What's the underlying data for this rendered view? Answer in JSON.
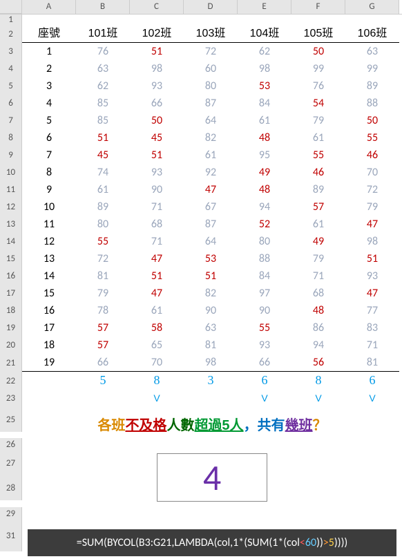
{
  "columns": [
    "A",
    "B",
    "C",
    "D",
    "E",
    "F",
    "G"
  ],
  "row_numbers": [
    1,
    2,
    3,
    4,
    5,
    6,
    7,
    8,
    9,
    10,
    11,
    12,
    13,
    14,
    15,
    16,
    17,
    18,
    19,
    20,
    21,
    22,
    23,
    25,
    26,
    27,
    28,
    29,
    31
  ],
  "header": {
    "seat": "座號",
    "classes": [
      "101班",
      "102班",
      "103班",
      "104班",
      "105班",
      "106班"
    ]
  },
  "threshold": 60,
  "count_threshold": 5,
  "chart_data": {
    "type": "table",
    "title": "各班成績與不及格統計",
    "columns": [
      "座號",
      "101班",
      "102班",
      "103班",
      "104班",
      "105班",
      "106班"
    ],
    "rows": [
      [
        1,
        76,
        51,
        72,
        62,
        50,
        63
      ],
      [
        2,
        63,
        98,
        60,
        98,
        99,
        99
      ],
      [
        3,
        62,
        93,
        80,
        53,
        76,
        89
      ],
      [
        4,
        85,
        66,
        87,
        84,
        54,
        88
      ],
      [
        5,
        85,
        50,
        64,
        61,
        79,
        50
      ],
      [
        6,
        51,
        45,
        82,
        48,
        61,
        55
      ],
      [
        7,
        45,
        51,
        61,
        95,
        55,
        46
      ],
      [
        8,
        74,
        93,
        92,
        49,
        46,
        70
      ],
      [
        9,
        61,
        90,
        47,
        48,
        89,
        72
      ],
      [
        10,
        89,
        71,
        67,
        94,
        57,
        79
      ],
      [
        11,
        80,
        68,
        87,
        52,
        61,
        47
      ],
      [
        12,
        55,
        71,
        64,
        80,
        49,
        98
      ],
      [
        13,
        72,
        47,
        53,
        88,
        79,
        51
      ],
      [
        14,
        81,
        51,
        51,
        84,
        71,
        93
      ],
      [
        15,
        79,
        47,
        82,
        97,
        68,
        47
      ],
      [
        16,
        78,
        61,
        90,
        90,
        48,
        77
      ],
      [
        17,
        57,
        58,
        63,
        55,
        86,
        83
      ],
      [
        18,
        57,
        65,
        81,
        93,
        94,
        71
      ],
      [
        19,
        66,
        70,
        98,
        66,
        56,
        81
      ]
    ],
    "fail_counts": [
      5,
      8,
      3,
      6,
      8,
      6
    ],
    "over5_marks": [
      "",
      "V",
      "",
      "V",
      "V",
      "V"
    ],
    "result": 4
  },
  "question": {
    "a": "各班",
    "b": "不及格",
    "c": "人數",
    "d": "超過5人",
    "e": "，共有",
    "f": "幾班",
    "g": "？"
  },
  "formula": {
    "pre": "=SUM(BYCOL(B3:G21,LAMBDA(col,1*(SUM(1*(col",
    "lt": "<",
    "n60": "60",
    "mid": "))",
    "gt": ">",
    "n5": "5",
    "post": "))))"
  }
}
